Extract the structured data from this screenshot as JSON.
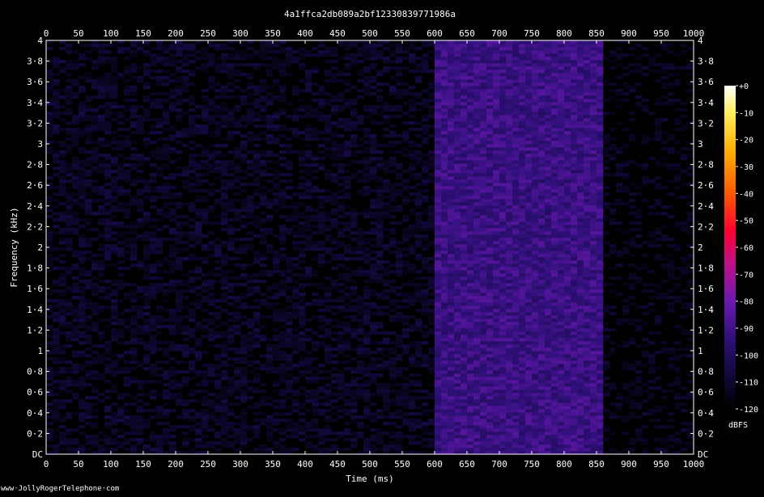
{
  "chart_data": {
    "type": "heatmap",
    "title": "4a1ffca2db089a2bf12330839771986a",
    "xlabel": "Time (ms)",
    "ylabel": "Frequency (kHz)",
    "xlim": [
      0,
      1000
    ],
    "ylim": [
      0,
      4
    ],
    "x_ticks": [
      0,
      50,
      100,
      150,
      200,
      250,
      300,
      350,
      400,
      450,
      500,
      550,
      600,
      650,
      700,
      750,
      800,
      850,
      900,
      950,
      1000
    ],
    "x_tick_labels": [
      "0",
      "50",
      "100",
      "150",
      "200",
      "250",
      "300",
      "350",
      "400",
      "450",
      "500",
      "550",
      "600",
      "650",
      "700",
      "750",
      "800",
      "850",
      "900",
      "950",
      "1000"
    ],
    "y_ticks": [
      0,
      0.2,
      0.4,
      0.6,
      0.8,
      1,
      1.2,
      1.4,
      1.6,
      1.8,
      2,
      2.2,
      2.4,
      2.6,
      2.8,
      3,
      3.2,
      3.4,
      3.6,
      3.8,
      4
    ],
    "y_tick_labels": [
      "DC",
      "0·2",
      "0·4",
      "0·6",
      "0·8",
      "1",
      "1·2",
      "1·4",
      "1·6",
      "1·8",
      "2",
      "2·2",
      "2·4",
      "2·6",
      "2·8",
      "3",
      "3·2",
      "3·4",
      "3·6",
      "3·8",
      "4"
    ],
    "colorbar": {
      "label": "dBFS",
      "range": [
        -120,
        0
      ],
      "ticks": [
        0,
        -10,
        -20,
        -30,
        -40,
        -50,
        -60,
        -70,
        -80,
        -90,
        -100,
        -110,
        -120
      ],
      "tick_labels": [
        "+0",
        "-10",
        "-20",
        "-30",
        "-40",
        "-50",
        "-60",
        "-70",
        "-80",
        "-90",
        "-100",
        "-110",
        "-120"
      ],
      "colors": [
        "#000000",
        "#1a0a40",
        "#3c0c78",
        "#7a15c0",
        "#d4007a",
        "#ff0020",
        "#ff6a00",
        "#ffc800",
        "#ffffff"
      ]
    },
    "signal_regions": [
      {
        "t_start": 0,
        "t_end": 600,
        "level_dbfs": -112
      },
      {
        "t_start": 600,
        "t_end": 865,
        "level_dbfs": -92
      },
      {
        "t_start": 865,
        "t_end": 1000,
        "level_dbfs": -115
      }
    ],
    "grid": false
  },
  "footer": {
    "credit": "www·JollyRogerTelephone·com"
  }
}
